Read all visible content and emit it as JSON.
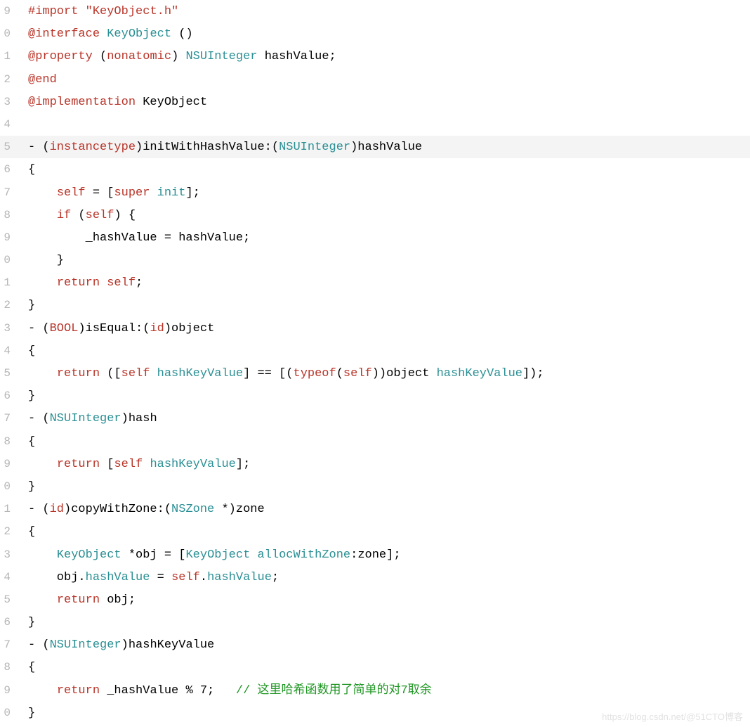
{
  "lines": [
    {
      "num": "9",
      "highlight": false,
      "spans": [
        {
          "cls": "k-pre",
          "t": "#import "
        },
        {
          "cls": "k-str",
          "t": "\"KeyObject.h\""
        }
      ]
    },
    {
      "num": "0",
      "highlight": false,
      "spans": [
        {
          "cls": "k-kw",
          "t": "@interface"
        },
        {
          "cls": "plain",
          "t": " "
        },
        {
          "cls": "k-type",
          "t": "KeyObject"
        },
        {
          "cls": "plain",
          "t": " ()"
        }
      ]
    },
    {
      "num": "1",
      "highlight": false,
      "spans": [
        {
          "cls": "k-kw",
          "t": "@property"
        },
        {
          "cls": "plain",
          "t": " ("
        },
        {
          "cls": "k-kw",
          "t": "nonatomic"
        },
        {
          "cls": "plain",
          "t": ") "
        },
        {
          "cls": "k-type",
          "t": "NSUInteger"
        },
        {
          "cls": "plain",
          "t": " hashValue;"
        }
      ]
    },
    {
      "num": "2",
      "highlight": false,
      "spans": [
        {
          "cls": "k-kw",
          "t": "@end"
        }
      ]
    },
    {
      "num": "3",
      "highlight": false,
      "spans": [
        {
          "cls": "k-kw",
          "t": "@implementation"
        },
        {
          "cls": "plain",
          "t": " KeyObject"
        }
      ]
    },
    {
      "num": "4",
      "highlight": false,
      "spans": []
    },
    {
      "num": "5",
      "highlight": true,
      "spans": [
        {
          "cls": "plain",
          "t": "- ("
        },
        {
          "cls": "k-kw",
          "t": "instancetype"
        },
        {
          "cls": "plain",
          "t": ")initWithHashValue:("
        },
        {
          "cls": "k-type",
          "t": "NSUInteger"
        },
        {
          "cls": "plain",
          "t": ")hashValue"
        }
      ]
    },
    {
      "num": "6",
      "highlight": false,
      "spans": [
        {
          "cls": "plain",
          "t": "{"
        }
      ]
    },
    {
      "num": "7",
      "highlight": false,
      "spans": [
        {
          "cls": "plain",
          "t": "    "
        },
        {
          "cls": "k-self",
          "t": "self"
        },
        {
          "cls": "plain",
          "t": " = ["
        },
        {
          "cls": "k-self",
          "t": "super"
        },
        {
          "cls": "plain",
          "t": " "
        },
        {
          "cls": "k-msg",
          "t": "init"
        },
        {
          "cls": "plain",
          "t": "];"
        }
      ]
    },
    {
      "num": "8",
      "highlight": false,
      "spans": [
        {
          "cls": "plain",
          "t": "    "
        },
        {
          "cls": "k-kw",
          "t": "if"
        },
        {
          "cls": "plain",
          "t": " ("
        },
        {
          "cls": "k-self",
          "t": "self"
        },
        {
          "cls": "plain",
          "t": ") {"
        }
      ]
    },
    {
      "num": "9",
      "highlight": false,
      "spans": [
        {
          "cls": "plain",
          "t": "        _hashValue = hashValue;"
        }
      ]
    },
    {
      "num": "0",
      "highlight": false,
      "spans": [
        {
          "cls": "plain",
          "t": "    }"
        }
      ]
    },
    {
      "num": "1",
      "highlight": false,
      "spans": [
        {
          "cls": "plain",
          "t": "    "
        },
        {
          "cls": "k-kw",
          "t": "return"
        },
        {
          "cls": "plain",
          "t": " "
        },
        {
          "cls": "k-self",
          "t": "self"
        },
        {
          "cls": "plain",
          "t": ";"
        }
      ]
    },
    {
      "num": "2",
      "highlight": false,
      "spans": [
        {
          "cls": "plain",
          "t": "}"
        }
      ]
    },
    {
      "num": "3",
      "highlight": false,
      "spans": [
        {
          "cls": "plain",
          "t": "- ("
        },
        {
          "cls": "k-kw",
          "t": "BOOL"
        },
        {
          "cls": "plain",
          "t": ")isEqual:("
        },
        {
          "cls": "k-kw",
          "t": "id"
        },
        {
          "cls": "plain",
          "t": ")object"
        }
      ]
    },
    {
      "num": "4",
      "highlight": false,
      "spans": [
        {
          "cls": "plain",
          "t": "{"
        }
      ]
    },
    {
      "num": "5",
      "highlight": false,
      "spans": [
        {
          "cls": "plain",
          "t": "    "
        },
        {
          "cls": "k-kw",
          "t": "return"
        },
        {
          "cls": "plain",
          "t": " (["
        },
        {
          "cls": "k-self",
          "t": "self"
        },
        {
          "cls": "plain",
          "t": " "
        },
        {
          "cls": "k-msg",
          "t": "hashKeyValue"
        },
        {
          "cls": "plain",
          "t": "] == [("
        },
        {
          "cls": "k-kw",
          "t": "typeof"
        },
        {
          "cls": "plain",
          "t": "("
        },
        {
          "cls": "k-self",
          "t": "self"
        },
        {
          "cls": "plain",
          "t": "))object "
        },
        {
          "cls": "k-msg",
          "t": "hashKeyValue"
        },
        {
          "cls": "plain",
          "t": "]);"
        }
      ]
    },
    {
      "num": "6",
      "highlight": false,
      "spans": [
        {
          "cls": "plain",
          "t": "}"
        }
      ]
    },
    {
      "num": "7",
      "highlight": false,
      "spans": [
        {
          "cls": "plain",
          "t": "- ("
        },
        {
          "cls": "k-type",
          "t": "NSUInteger"
        },
        {
          "cls": "plain",
          "t": ")hash"
        }
      ]
    },
    {
      "num": "8",
      "highlight": false,
      "spans": [
        {
          "cls": "plain",
          "t": "{"
        }
      ]
    },
    {
      "num": "9",
      "highlight": false,
      "spans": [
        {
          "cls": "plain",
          "t": "    "
        },
        {
          "cls": "k-kw",
          "t": "return"
        },
        {
          "cls": "plain",
          "t": " ["
        },
        {
          "cls": "k-self",
          "t": "self"
        },
        {
          "cls": "plain",
          "t": " "
        },
        {
          "cls": "k-msg",
          "t": "hashKeyValue"
        },
        {
          "cls": "plain",
          "t": "];"
        }
      ]
    },
    {
      "num": "0",
      "highlight": false,
      "spans": [
        {
          "cls": "plain",
          "t": "}"
        }
      ]
    },
    {
      "num": "1",
      "highlight": false,
      "spans": [
        {
          "cls": "plain",
          "t": "- ("
        },
        {
          "cls": "k-kw",
          "t": "id"
        },
        {
          "cls": "plain",
          "t": ")copyWithZone:("
        },
        {
          "cls": "k-type",
          "t": "NSZone"
        },
        {
          "cls": "plain",
          "t": " *)zone"
        }
      ]
    },
    {
      "num": "2",
      "highlight": false,
      "spans": [
        {
          "cls": "plain",
          "t": "{"
        }
      ]
    },
    {
      "num": "3",
      "highlight": false,
      "spans": [
        {
          "cls": "plain",
          "t": "    "
        },
        {
          "cls": "k-type",
          "t": "KeyObject"
        },
        {
          "cls": "plain",
          "t": " *obj = ["
        },
        {
          "cls": "k-type",
          "t": "KeyObject"
        },
        {
          "cls": "plain",
          "t": " "
        },
        {
          "cls": "k-msg",
          "t": "allocWithZone"
        },
        {
          "cls": "plain",
          "t": ":zone];"
        }
      ]
    },
    {
      "num": "4",
      "highlight": false,
      "spans": [
        {
          "cls": "plain",
          "t": "    obj."
        },
        {
          "cls": "k-prop",
          "t": "hashValue"
        },
        {
          "cls": "plain",
          "t": " = "
        },
        {
          "cls": "k-self",
          "t": "self"
        },
        {
          "cls": "plain",
          "t": "."
        },
        {
          "cls": "k-prop",
          "t": "hashValue"
        },
        {
          "cls": "plain",
          "t": ";"
        }
      ]
    },
    {
      "num": "5",
      "highlight": false,
      "spans": [
        {
          "cls": "plain",
          "t": "    "
        },
        {
          "cls": "k-kw",
          "t": "return"
        },
        {
          "cls": "plain",
          "t": " obj;"
        }
      ]
    },
    {
      "num": "6",
      "highlight": false,
      "spans": [
        {
          "cls": "plain",
          "t": "}"
        }
      ]
    },
    {
      "num": "7",
      "highlight": false,
      "spans": [
        {
          "cls": "plain",
          "t": "- ("
        },
        {
          "cls": "k-type",
          "t": "NSUInteger"
        },
        {
          "cls": "plain",
          "t": ")hashKeyValue"
        }
      ]
    },
    {
      "num": "8",
      "highlight": false,
      "spans": [
        {
          "cls": "plain",
          "t": "{"
        }
      ]
    },
    {
      "num": "9",
      "highlight": false,
      "spans": [
        {
          "cls": "plain",
          "t": "    "
        },
        {
          "cls": "k-kw",
          "t": "return"
        },
        {
          "cls": "plain",
          "t": " _hashValue % 7;   "
        },
        {
          "cls": "k-cmt",
          "t": "// 这里哈希函数用了简单的对7取余"
        }
      ]
    },
    {
      "num": "0",
      "highlight": false,
      "spans": [
        {
          "cls": "plain",
          "t": "}"
        }
      ]
    }
  ],
  "watermark": "https://blog.csdn.net/@51CTO博客"
}
